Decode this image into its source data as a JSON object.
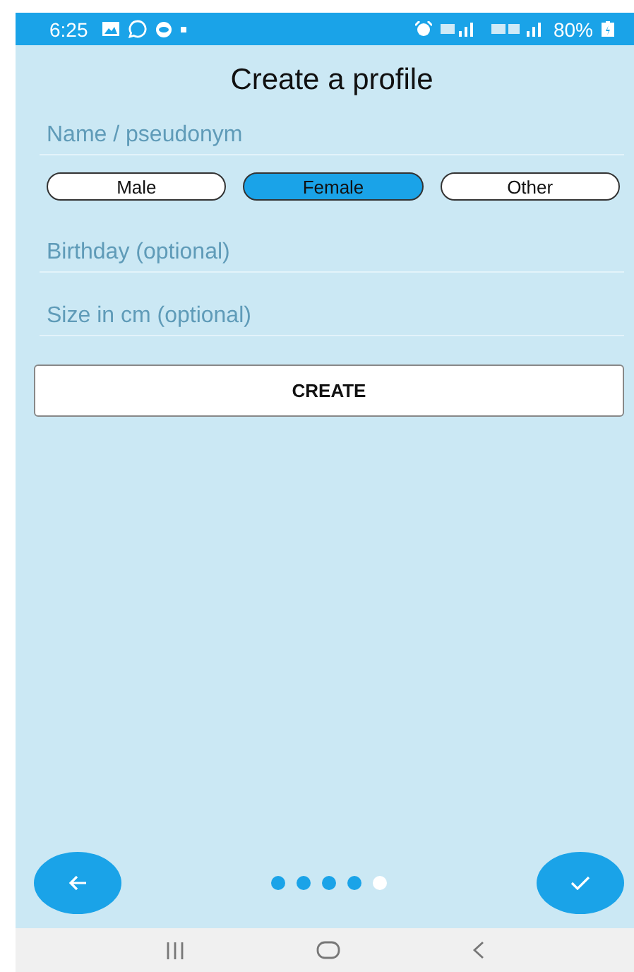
{
  "status_bar": {
    "time": "6:25",
    "battery": "80%"
  },
  "title": "Create a profile",
  "fields": [
    {
      "placeholder": "Name / pseudonym"
    },
    {
      "placeholder": "Birthday (optional)"
    },
    {
      "placeholder": "Size in cm (optional)"
    }
  ],
  "gender_options": [
    {
      "label": "Male",
      "selected": false
    },
    {
      "label": "Female",
      "selected": true
    },
    {
      "label": "Other",
      "selected": false
    }
  ],
  "create_button": "CREATE",
  "page_dots": [
    {
      "selected": false
    },
    {
      "selected": false
    },
    {
      "selected": false
    },
    {
      "selected": false
    },
    {
      "selected": true
    }
  ]
}
